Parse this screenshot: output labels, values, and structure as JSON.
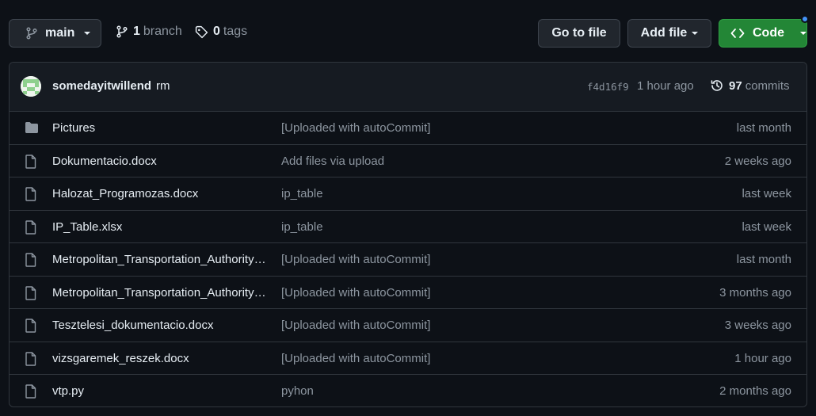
{
  "toolbar": {
    "branch_name": "main",
    "branches_count": "1",
    "branches_label": "branch",
    "tags_count": "0",
    "tags_label": "tags",
    "go_to_file_label": "Go to file",
    "add_file_label": "Add file",
    "code_label": "Code"
  },
  "commit": {
    "author": "somedayitwillend",
    "message": "rm",
    "sha": "f4d16f9",
    "time": "1 hour ago",
    "commits_count": "97",
    "commits_label": "commits"
  },
  "files": [
    {
      "type": "folder",
      "name": "Pictures",
      "message": "[Uploaded with autoCommit]",
      "time": "last month"
    },
    {
      "type": "file",
      "name": "Dokumentacio.docx",
      "message": "Add files via upload",
      "time": "2 weeks ago"
    },
    {
      "type": "file",
      "name": "Halozat_Programozas.docx",
      "message": "ip_table",
      "time": "last week"
    },
    {
      "type": "file",
      "name": "IP_Table.xlsx",
      "message": "ip_table",
      "time": "last week"
    },
    {
      "type": "file",
      "name": "Metropolitan_Transportation_Authority…",
      "message": "[Uploaded with autoCommit]",
      "time": "last month"
    },
    {
      "type": "file",
      "name": "Metropolitan_Transportation_Authority…",
      "message": "[Uploaded with autoCommit]",
      "time": "3 months ago"
    },
    {
      "type": "file",
      "name": "Tesztelesi_dokumentacio.docx",
      "message": "[Uploaded with autoCommit]",
      "time": "3 weeks ago"
    },
    {
      "type": "file",
      "name": "vizsgaremek_reszek.docx",
      "message": "[Uploaded with autoCommit]",
      "time": "1 hour ago"
    },
    {
      "type": "file",
      "name": "vtp.py",
      "message": "pyhon",
      "time": "2 months ago"
    }
  ],
  "colors": {
    "background": "#0d1117",
    "code_button": "#238636",
    "notification_dot": "#4493f8"
  }
}
